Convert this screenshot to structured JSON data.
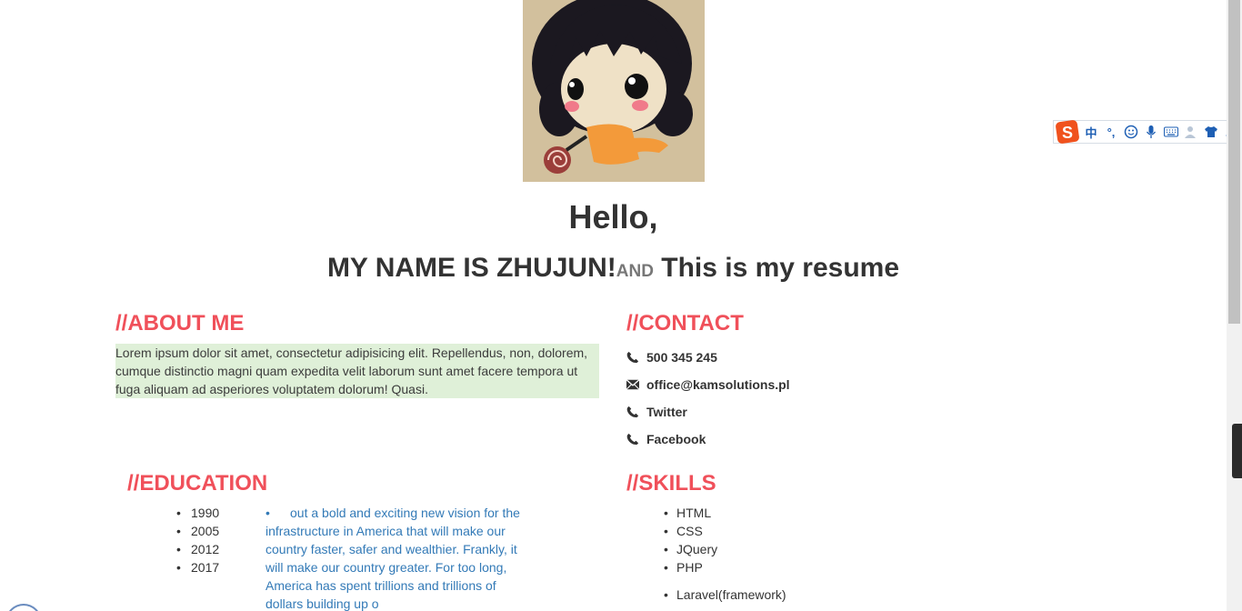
{
  "header": {
    "greeting": "Hello,",
    "name_line": "MY NAME IS ZHUJUN!",
    "and_word": "AND",
    "tagline": " This is my resume"
  },
  "about": {
    "title": "//ABOUT ME",
    "text": "Lorem ipsum dolor sit amet, consectetur adipisicing elit. Repellendus, non, dolorem, cumque distinctio magni quam expedita velit laborum sunt amet facere tempora ut fuga aliquam ad asperiores voluptatem dolorum! Quasi."
  },
  "contact": {
    "title": "//CONTACT",
    "items": [
      {
        "icon": "phone-icon",
        "label": "500 345 245"
      },
      {
        "icon": "envelope-icon",
        "label": "office@kamsolutions.pl"
      },
      {
        "icon": "phone-icon",
        "label": "Twitter"
      },
      {
        "icon": "phone-icon",
        "label": "Facebook"
      }
    ]
  },
  "education": {
    "title": "//EDUCATION",
    "years": [
      "1990",
      "2005",
      "2012",
      "2017"
    ],
    "description": "out a bold and exciting new vision for the infrastructure in America that will make our country faster, safer and wealthier. Frankly, it will make our country greater. For too long, America has spent trillions and trillions of dollars building up o"
  },
  "skills": {
    "title": "//SKILLS",
    "items": [
      "HTML",
      "CSS",
      "JQuery",
      "PHP"
    ],
    "items2": [
      "Laravel(framework)"
    ]
  },
  "ime_toolbar": {
    "mode_label": "中",
    "punct_label": "°,"
  },
  "colors": {
    "accent": "#f0505a",
    "about_bg": "#dff0d8",
    "link": "#337ab7"
  }
}
